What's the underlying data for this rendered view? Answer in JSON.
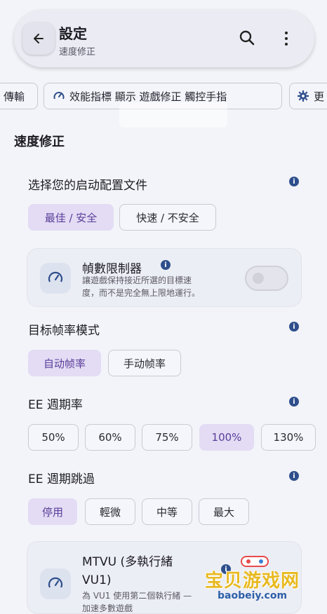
{
  "header": {
    "title": "設定",
    "subtitle": "速度修正"
  },
  "tabs": [
    {
      "label": "傳輸"
    },
    {
      "label": "效能指標 顯示 遊戲修正 觸控手指"
    },
    {
      "label": "更"
    }
  ],
  "section": {
    "title": "速度修正"
  },
  "profile": {
    "label": "选择您的启动配置文件",
    "options": [
      "最佳 / 安全",
      "快速 / 不安全"
    ],
    "selected": "最佳 / 安全"
  },
  "frame_limiter": {
    "title": "幀數限制器",
    "description_line1": "讓遊戲保持接近所選的目標速",
    "description_line2": "度，而不是完全無上限地運行。",
    "enabled": false
  },
  "target_framerate": {
    "label": "目标帧率模式",
    "options": [
      "自动帧率",
      "手动帧率"
    ],
    "selected": "自动帧率"
  },
  "ee_cycle_rate": {
    "label": "EE 週期率",
    "options": [
      "50%",
      "60%",
      "75%",
      "100%",
      "130%"
    ],
    "selected": "100%"
  },
  "ee_cycle_skip": {
    "label": "EE 週期跳過",
    "options": [
      "停用",
      "輕微",
      "中等",
      "最大"
    ],
    "selected": "停用"
  },
  "mtvu": {
    "title_line1": "MTVU (多執行緒",
    "title_line2": "VU1)",
    "description_line1": "為 VU1 使用第二個執行緒 —",
    "description_line2": "加速多數遊戲"
  },
  "watermark": {
    "main": "宝贝游戏网",
    "url": "baobeiy.com"
  },
  "colors": {
    "accent_selected_bg": "#e3dcf4",
    "accent_selected_text": "#5a3d9a",
    "info_icon": "#2f4f8c",
    "background": "#f3f4f9"
  }
}
